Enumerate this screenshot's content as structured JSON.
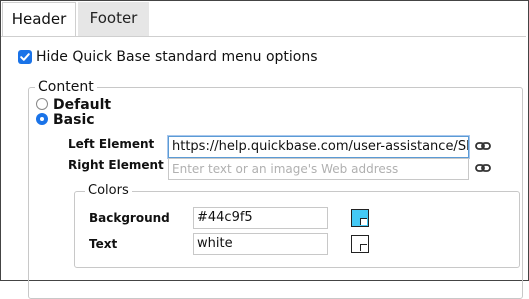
{
  "tabs": [
    {
      "label": "Header",
      "active": true
    },
    {
      "label": "Footer",
      "active": false
    }
  ],
  "hide_menu": {
    "label": "Hide Quick Base standard menu options",
    "checked": true
  },
  "content": {
    "legend": "Content",
    "radios": [
      {
        "label": "Default",
        "selected": false
      },
      {
        "label": "Basic",
        "selected": true
      }
    ],
    "left_element": {
      "label": "Left Element",
      "value": "https://help.quickbase.com/user-assistance/Skins/"
    },
    "right_element": {
      "label": "Right Element",
      "placeholder": "Enter text or an image's Web address"
    }
  },
  "colors": {
    "legend": "Colors",
    "background": {
      "label": "Background",
      "value": "#44c9f5",
      "swatch_color": "#44c9f5"
    },
    "text": {
      "label": "Text",
      "value": "white",
      "swatch_color": "#ffffff"
    }
  },
  "icons": {
    "link": "chain-link-icon",
    "checkbox": "checkmark-icon",
    "swatch": "color-swatch-icon"
  },
  "accent_color": "#1a73e8"
}
